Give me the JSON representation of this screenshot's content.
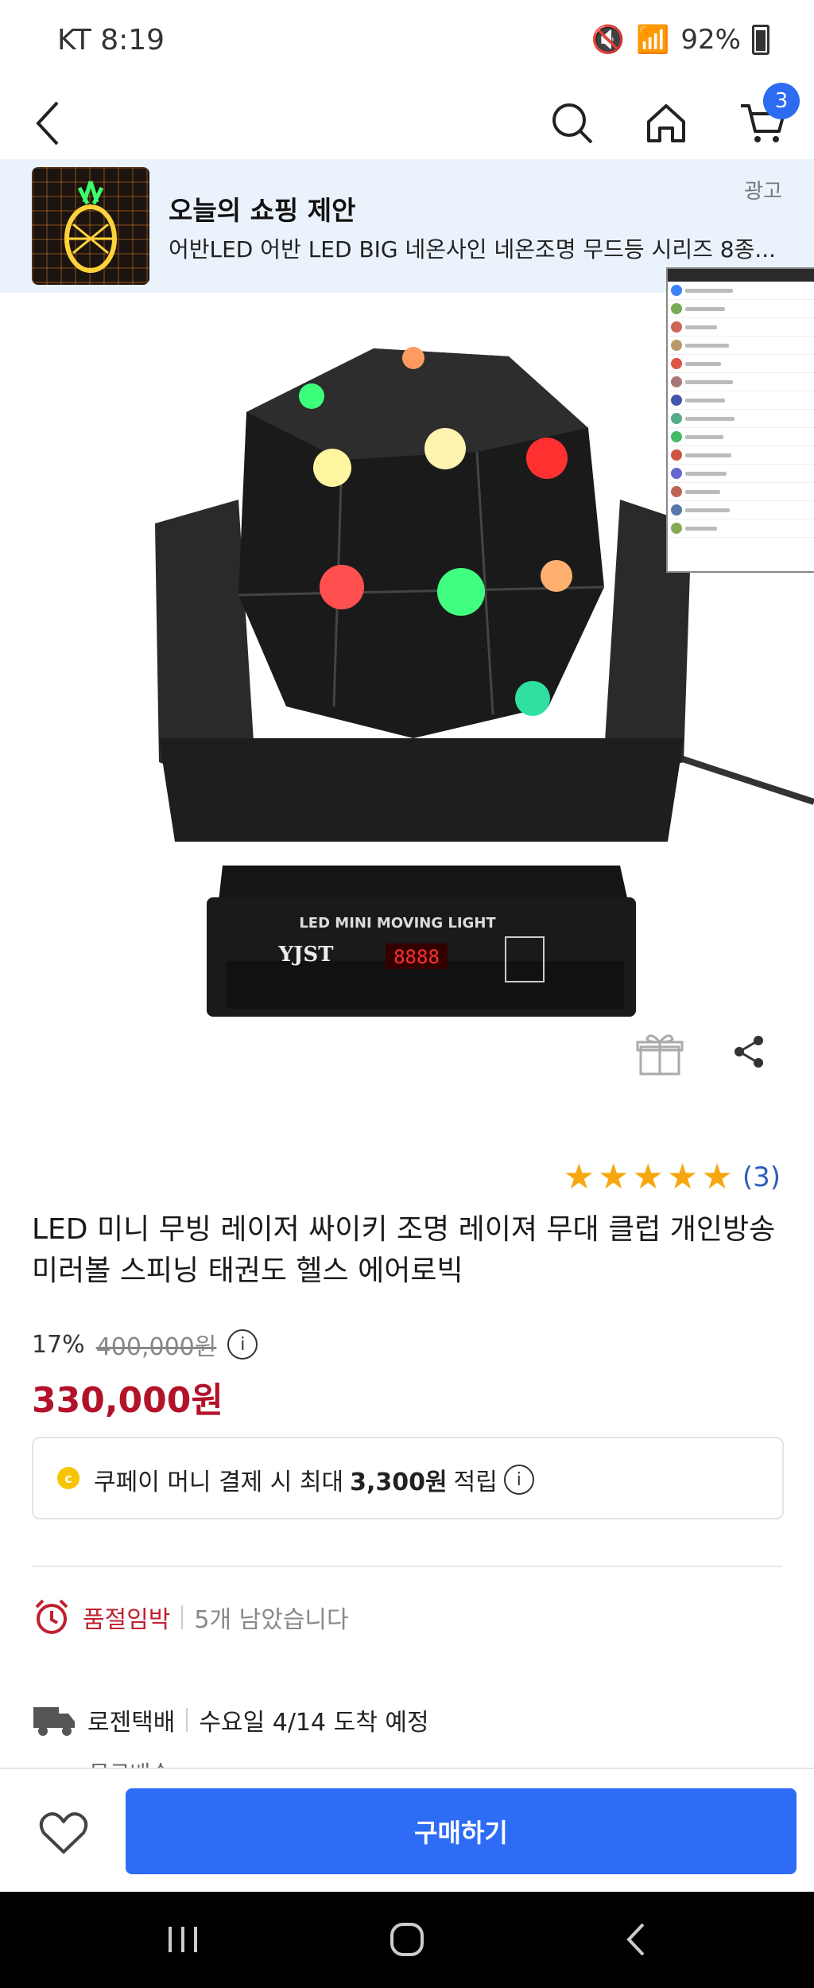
{
  "status": {
    "carrier_time": "KT 8:19",
    "battery": "92%"
  },
  "cart": {
    "badge": "3"
  },
  "ad": {
    "title": "오늘의 쇼핑 제안",
    "description": "어반LED 어반 LED BIG 네온사인 네온조명 무드등 시리즈 8종...",
    "tag": "광고"
  },
  "product": {
    "label_on_device": "LED MINI MOVING LIGHT",
    "brand_on_device": "YJST",
    "display_on_device": "8888",
    "rating_stars": 5,
    "review_count": "(3)",
    "title": "LED 미니 무빙 레이저 싸이키 조명 레이져 무대 클럽 개인방송 미러볼 스피닝 태권도 헬스 에어로빅",
    "discount": "17%",
    "original_price": "400,000원",
    "sale_price": "330,000원"
  },
  "coupay": {
    "text": "쿠페이 머니 결제 시 최대",
    "amount": "3,300원",
    "suffix": "적립"
  },
  "stock": {
    "label": "품절임박",
    "detail": "5개 남았습니다"
  },
  "delivery": {
    "carrier": "로젠택배",
    "eta": "수요일 4/14 도착 예정",
    "fee": "무료배송"
  },
  "actions": {
    "buy_label": "구매하기"
  },
  "colors": {
    "accent": "#2e6cf6",
    "price": "#b3132a",
    "star": "#f6a70f",
    "badge": "#2d6bf0"
  }
}
